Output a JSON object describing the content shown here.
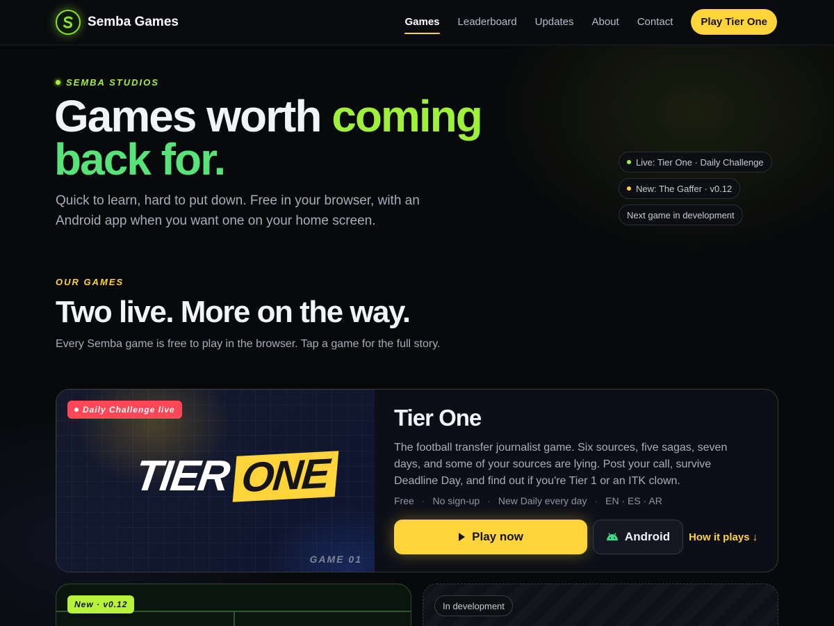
{
  "brand": {
    "name": "Semba Games",
    "logo_letter": "S"
  },
  "nav": {
    "links": [
      {
        "label": "Games",
        "active": true
      },
      {
        "label": "Leaderboard",
        "active": false
      },
      {
        "label": "Updates",
        "active": false
      },
      {
        "label": "About",
        "active": false
      },
      {
        "label": "Contact",
        "active": false
      }
    ],
    "cta": "Play Tier One"
  },
  "hero": {
    "eyebrow": "SEMBA STUDIOS",
    "title_part1": "Games worth ",
    "title_highlight1": "coming",
    "title_highlight2": "back for.",
    "subtitle": "Quick to learn, hard to put down. Free in your browser, with an Android app when you want one on your home screen.",
    "pills": [
      {
        "label": "Live: Tier One · Daily Challenge",
        "dot_color": "#a3f23a"
      },
      {
        "label": "New: The Gaffer · v0.12",
        "dot_color": "#ffd43b"
      },
      {
        "label": "Next game in development",
        "dot_color": ""
      }
    ]
  },
  "games_section": {
    "eyebrow": "OUR GAMES",
    "title": "Two live. More on the way.",
    "subtitle": "Every Semba game is free to play in the browser. Tap a game for the full story."
  },
  "featured_game": {
    "badge": "Daily Challenge live",
    "logo_word1": "TIER",
    "logo_word2": "ONE",
    "game_number": "GAME 01",
    "title": "Tier One",
    "description": "The football transfer journalist game. Six sources, five sagas, seven days, and some of your sources are lying. Post your call, survive Deadline Day, and find out if you're Tier 1 or an ITK clown.",
    "meta": [
      "Free",
      "No sign-up",
      "New Daily every day",
      "EN · ES · AR"
    ],
    "play_label": "Play now",
    "android_label": "Android",
    "how_label": "How it plays ↓"
  },
  "second_game": {
    "badge": "New · v0.12"
  },
  "third_game": {
    "badge": "In development"
  },
  "colors": {
    "accent": "#ffd43b",
    "green": "#9ef03b",
    "live_red": "#ff4757"
  }
}
